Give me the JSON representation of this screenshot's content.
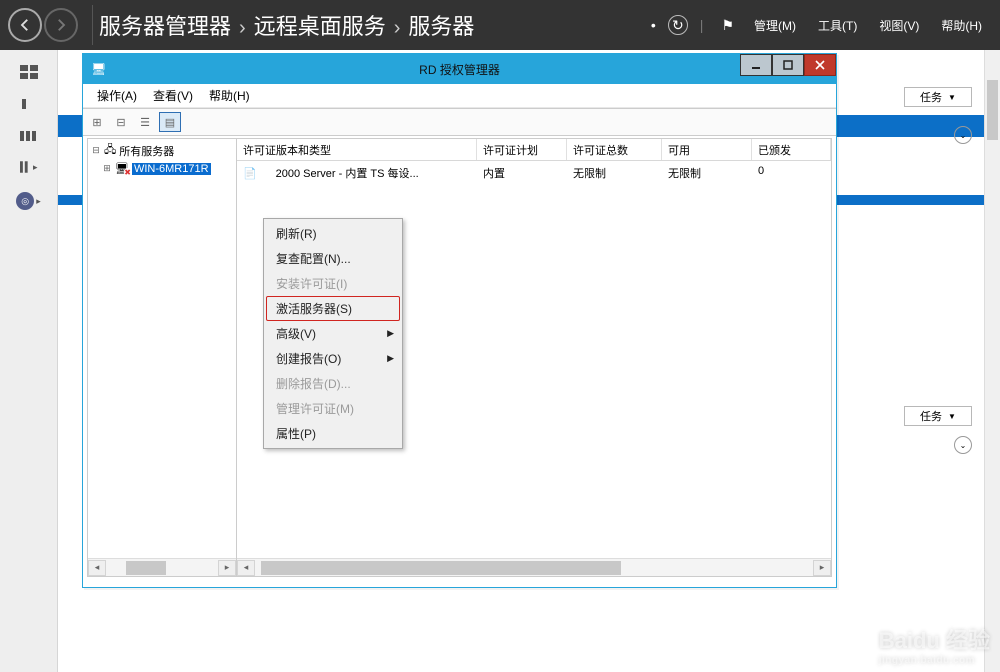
{
  "header": {
    "breadcrumb": {
      "main": "服务器管理器",
      "sub1": "远程桌面服务",
      "sub2": "服务器"
    },
    "menu": {
      "manage": "管理(M)",
      "tools": "工具(T)",
      "view": "视图(V)",
      "help": "帮助(H)"
    }
  },
  "bg": {
    "tasks": "任务",
    "dropdown_arrow": "▼"
  },
  "window": {
    "title": "RD 授权管理器",
    "menu": {
      "action": "操作(A)",
      "view": "查看(V)",
      "help": "帮助(H)"
    }
  },
  "tree": {
    "root": "所有服务器",
    "server": "WIN-6MR171R"
  },
  "columns": {
    "type": "许可证版本和类型",
    "plan": "许可证计划",
    "total": "许可证总数",
    "avail": "可用",
    "issued": "已颁发"
  },
  "row": {
    "type": "2000 Server - 内置 TS 每设...",
    "plan": "内置",
    "total": "无限制",
    "avail": "无限制",
    "issued": "0"
  },
  "ctx": {
    "refresh": "刷新(R)",
    "review": "复查配置(N)...",
    "install": "安装许可证(I)",
    "activate": "激活服务器(S)",
    "advanced": "高级(V)",
    "create_report": "创建报告(O)",
    "delete_report": "删除报告(D)...",
    "manage_lic": "管理许可证(M)",
    "properties": "属性(P)"
  },
  "watermark": {
    "brand": "Baidu",
    "cat": "经验",
    "sub": "jingyan.baidu.com"
  }
}
